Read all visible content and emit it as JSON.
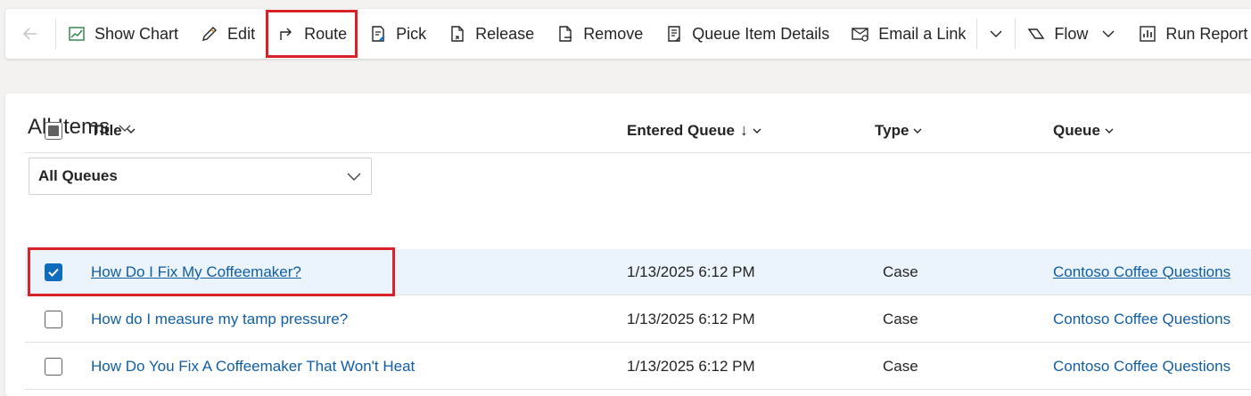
{
  "toolbar": {
    "buttons": [
      {
        "label": "Show Chart",
        "icon": "chart-icon"
      },
      {
        "label": "Edit",
        "icon": "pencil-icon"
      },
      {
        "label": "Route",
        "icon": "route-icon"
      },
      {
        "label": "Pick",
        "icon": "pick-icon"
      },
      {
        "label": "Release",
        "icon": "release-icon"
      },
      {
        "label": "Remove",
        "icon": "remove-icon"
      },
      {
        "label": "Queue Item Details",
        "icon": "details-icon"
      },
      {
        "label": "Email a Link",
        "icon": "email-icon"
      },
      {
        "label": "Flow",
        "icon": "flow-icon"
      },
      {
        "label": "Run Report",
        "icon": "report-icon"
      }
    ]
  },
  "view": {
    "title": "All Items",
    "queue_filter": "All Queues"
  },
  "grid": {
    "columns": [
      "Title",
      "Entered Queue",
      "Type",
      "Queue"
    ],
    "sort_indicator": "↓",
    "rows": [
      {
        "title": "How Do I Fix My Coffeemaker?",
        "entered": "1/13/2025 6:12 PM",
        "type": "Case",
        "queue": "Contoso Coffee Questions",
        "checked": true
      },
      {
        "title": "How do I measure my tamp pressure?",
        "entered": "1/13/2025 6:12 PM",
        "type": "Case",
        "queue": "Contoso Coffee Questions",
        "checked": false
      },
      {
        "title": "How Do You Fix A Coffeemaker That Won't Heat",
        "entered": "1/13/2025 6:12 PM",
        "type": "Case",
        "queue": "Contoso Coffee Questions",
        "checked": false
      }
    ]
  },
  "colors": {
    "accent": "#0f6cbd",
    "link": "#115ea3",
    "highlight": "#d9212a",
    "selected_row": "#ebf3fc"
  }
}
